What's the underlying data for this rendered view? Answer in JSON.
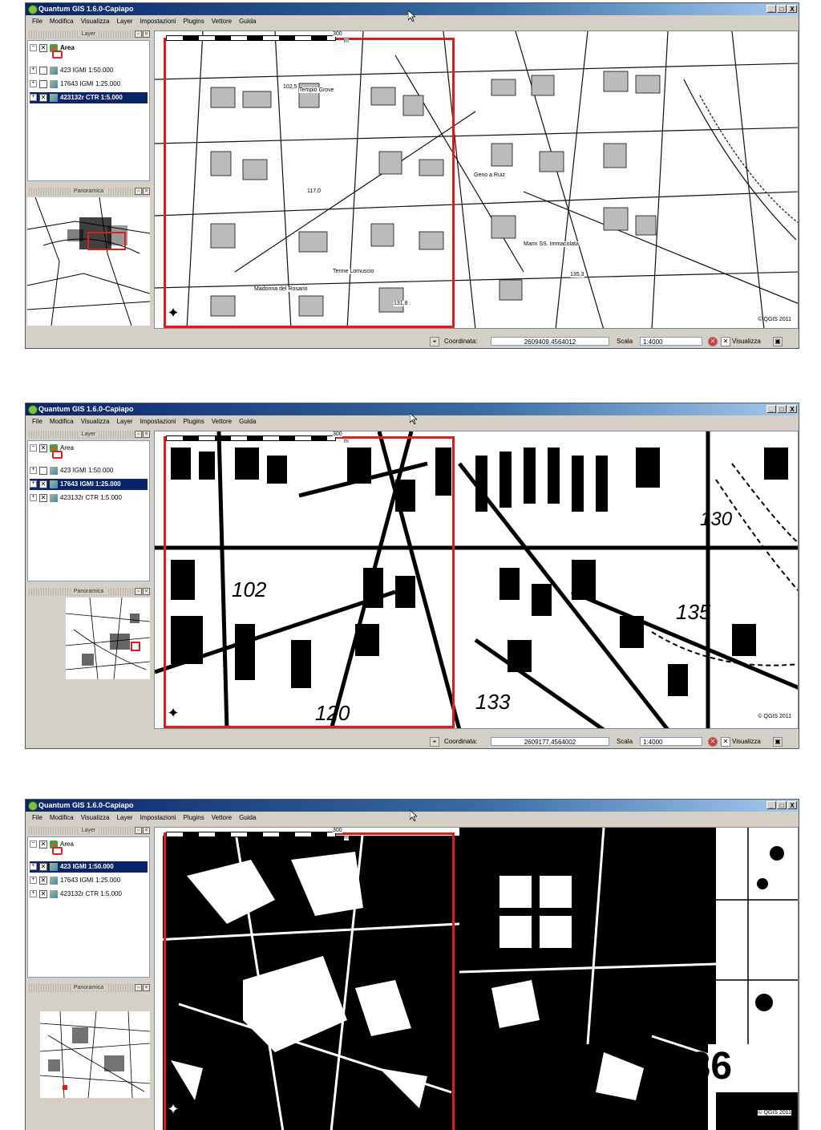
{
  "app": {
    "title": "Quantum GIS 1.6.0-Capiapo",
    "menus": [
      "File",
      "Modifica",
      "Visualizza",
      "Layer",
      "Impostazioni",
      "Plugins",
      "Vettore",
      "Guida"
    ],
    "window_buttons": [
      "_",
      "□",
      "X"
    ],
    "layer_panel_title": "Layer",
    "overview_panel_title": "Panoramica",
    "coord_label": "Coordinata:",
    "scale_label": "Scala",
    "render_label": "Visualizza",
    "copyright": "© QGIS 2011"
  },
  "screens": [
    {
      "layers": [
        {
          "name": "Area",
          "checked": true,
          "selected": false
        },
        {
          "name": "423 IGMI 1:50.000",
          "checked": false,
          "selected": false
        },
        {
          "name": "17643 IGMI 1:25.000",
          "checked": false,
          "selected": false
        },
        {
          "name": "423132r CTR 1:5.000",
          "checked": true,
          "selected": true
        }
      ],
      "coordinate": "2609409,4564012",
      "scale": "1:4000",
      "scalebar_value": "300",
      "scalebar_unit": "m",
      "map_labels": [
        "Tempio Grove",
        "Terme Lomuscio",
        "Madonna del Rosario",
        "Marin SS. Immacolata",
        "Geno a Ruiz",
        "117,0",
        "102,5",
        "131,8",
        "135,3"
      ]
    },
    {
      "layers": [
        {
          "name": "Area",
          "checked": true,
          "selected": false
        },
        {
          "name": "423 IGMI 1:50.000",
          "checked": false,
          "selected": false
        },
        {
          "name": "17643 IGMI 1:25.000",
          "checked": true,
          "selected": true
        },
        {
          "name": "423132r CTR 1:5.000",
          "checked": true,
          "selected": false
        }
      ],
      "coordinate": "2609177,4564002",
      "scale": "1:4000",
      "scalebar_value": "300",
      "scalebar_unit": "m",
      "map_labels": [
        "102",
        "120",
        "133",
        "135",
        "130"
      ]
    },
    {
      "layers": [
        {
          "name": "Area",
          "checked": true,
          "selected": false
        },
        {
          "name": "423 IGMI 1:50.000",
          "checked": true,
          "selected": true
        },
        {
          "name": "17643 IGMI 1:25.000",
          "checked": true,
          "selected": false
        },
        {
          "name": "423132r CTR 1:5.000",
          "checked": true,
          "selected": false
        }
      ],
      "scalebar_value": "300",
      "scalebar_unit": "m",
      "map_labels": [
        "136"
      ]
    }
  ]
}
